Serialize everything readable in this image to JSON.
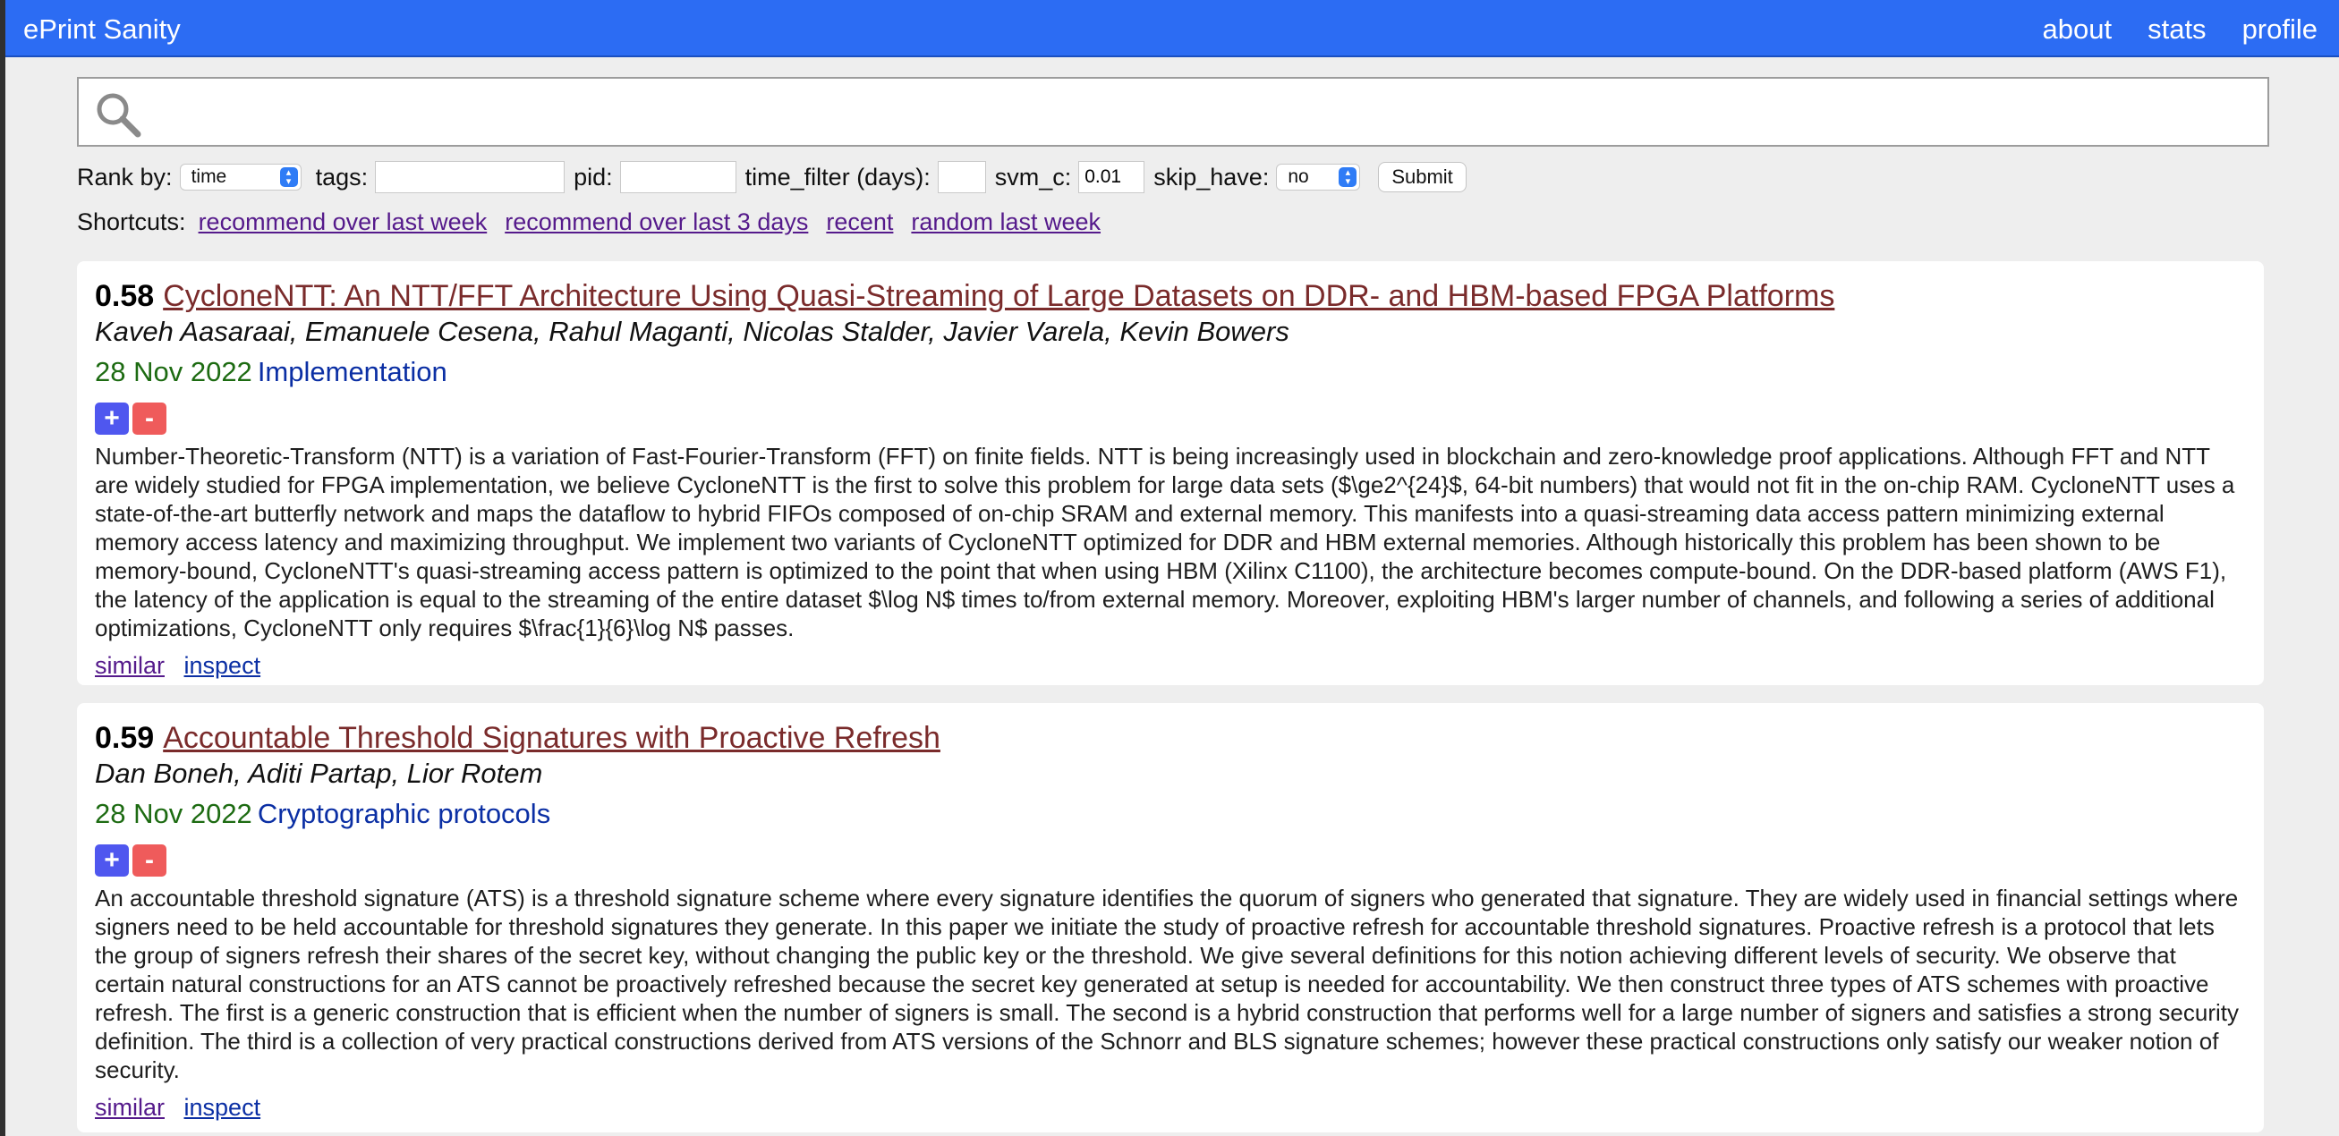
{
  "header": {
    "brand": "ePrint Sanity",
    "nav": [
      "about",
      "stats",
      "profile"
    ]
  },
  "search": {
    "placeholder": "",
    "value": ""
  },
  "controls": {
    "rank_by_label": "Rank by:",
    "rank_by_value": "time",
    "tags_label": "tags:",
    "tags_value": "",
    "pid_label": "pid:",
    "pid_value": "",
    "time_filter_label": "time_filter (days):",
    "time_filter_value": "",
    "svm_c_label": "svm_c:",
    "svm_c_value": "0.01",
    "skip_have_label": "skip_have:",
    "skip_have_value": "no",
    "submit_label": "Submit"
  },
  "shortcuts": {
    "label": "Shortcuts:",
    "links": [
      "recommend over last week",
      "recommend over last 3 days",
      "recent",
      "random last week"
    ]
  },
  "papers": [
    {
      "score": "0.58",
      "title": "CycloneNTT: An NTT/FFT Architecture Using Quasi-Streaming of Large Datasets on DDR- and HBM-based FPGA Platforms",
      "authors": "Kaveh Aasaraai, Emanuele Cesena, Rahul Maganti, Nicolas Stalder, Javier Varela, Kevin Bowers",
      "date": "28 Nov 2022",
      "category": "Implementation",
      "vote_up": "+",
      "vote_down": "-",
      "abstract": "Number-Theoretic-Transform (NTT) is a variation of Fast-Fourier-Transform (FFT) on finite fields. NTT is being increasingly used in blockchain and zero-knowledge proof applications. Although FFT and NTT are widely studied for FPGA implementation, we believe CycloneNTT is the first to solve this problem for large data sets ($\\ge2^{24}$, 64-bit numbers) that would not fit in the on-chip RAM. CycloneNTT uses a state-of-the-art butterfly network and maps the dataflow to hybrid FIFOs composed of on-chip SRAM and external memory. This manifests into a quasi-streaming data access pattern minimizing external memory access latency and maximizing throughput. We implement two variants of CycloneNTT optimized for DDR and HBM external memories. Although historically this problem has been shown to be memory-bound, CycloneNTT's quasi-streaming access pattern is optimized to the point that when using HBM (Xilinx C1100), the architecture becomes compute-bound. On the DDR-based platform (AWS F1), the latency of the application is equal to the streaming of the entire dataset $\\log N$ times to/from external memory. Moreover, exploiting HBM's larger number of channels, and following a series of additional optimizations, CycloneNTT only requires $\\frac{1}{6}\\log N$ passes.",
      "link_similar": "similar",
      "link_inspect": "inspect"
    },
    {
      "score": "0.59",
      "title": "Accountable Threshold Signatures with Proactive Refresh",
      "authors": "Dan Boneh, Aditi Partap, Lior Rotem",
      "date": "28 Nov 2022",
      "category": "Cryptographic protocols",
      "vote_up": "+",
      "vote_down": "-",
      "abstract": "An accountable threshold signature (ATS) is a threshold signature scheme where every signature identifies the quorum of signers who generated that signature. They are widely used in financial settings where signers need to be held accountable for threshold signatures they generate. In this paper we initiate the study of proactive refresh for accountable threshold signatures. Proactive refresh is a protocol that lets the group of signers refresh their shares of the secret key, without changing the public key or the threshold. We give several definitions for this notion achieving different levels of security. We observe that certain natural constructions for an ATS cannot be proactively refreshed because the secret key generated at setup is needed for accountability. We then construct three types of ATS schemes with proactive refresh. The first is a generic construction that is efficient when the number of signers is small. The second is a hybrid construction that performs well for a large number of signers and satisfies a strong security definition. The third is a collection of very practical constructions derived from ATS versions of the Schnorr and BLS signature schemes; however these practical constructions only satisfy our weaker notion of security.",
      "link_similar": "similar",
      "link_inspect": "inspect"
    }
  ]
}
